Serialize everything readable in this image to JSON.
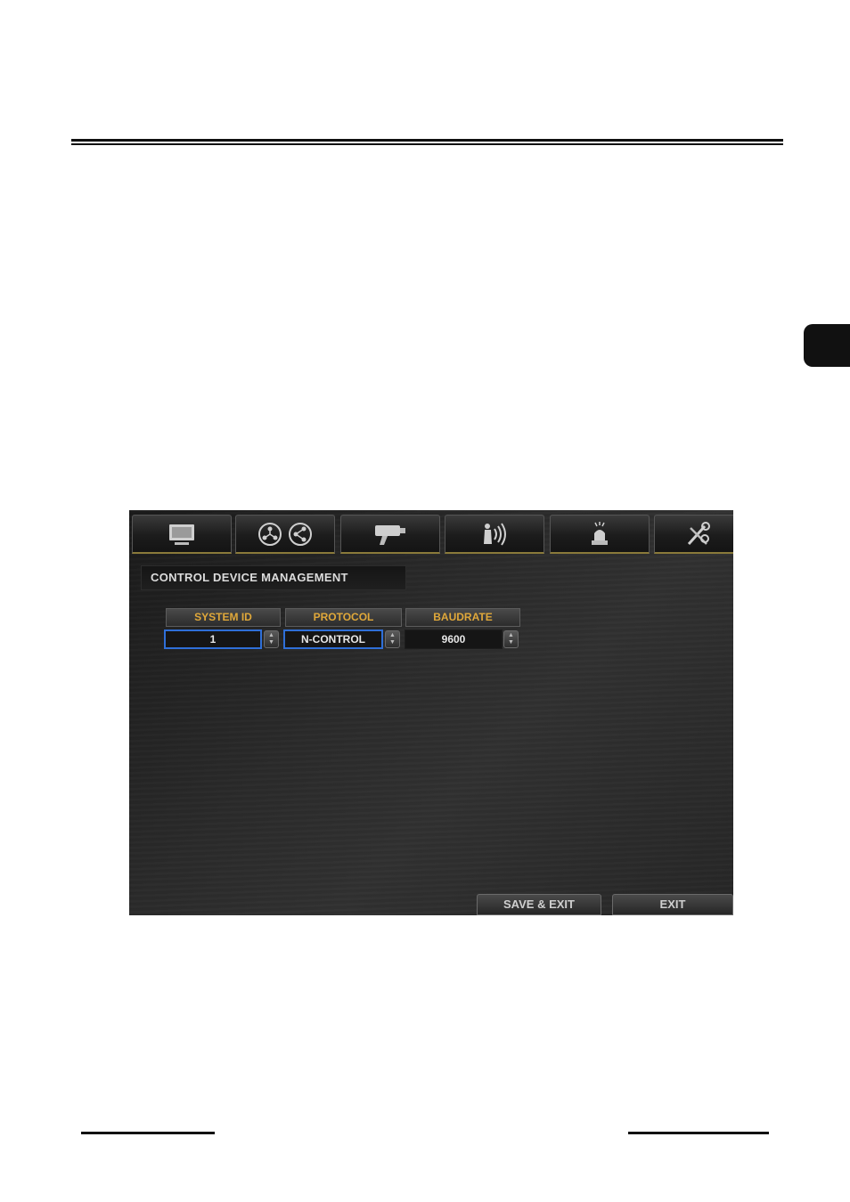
{
  "dvr_screen": {
    "tabs": [
      {
        "icon": "monitor-icon"
      },
      {
        "icon": "network-icon"
      },
      {
        "icon": "camera-icon"
      },
      {
        "icon": "audio-icon"
      },
      {
        "icon": "alarm-icon"
      },
      {
        "icon": "tools-icon"
      }
    ],
    "section_title": "CONTROL DEVICE MANAGEMENT",
    "columns": {
      "system_id": {
        "header": "SYSTEM ID",
        "value": "1"
      },
      "protocol": {
        "header": "PROTOCOL",
        "value": "N-CONTROL"
      },
      "baudrate": {
        "header": "BAUDRATE",
        "value": "9600"
      }
    },
    "buttons": {
      "save_exit": "SAVE & EXIT",
      "exit": "EXIT"
    },
    "colors": {
      "header_text": "#e0a83a",
      "focus_border": "#2f6fd8"
    }
  }
}
